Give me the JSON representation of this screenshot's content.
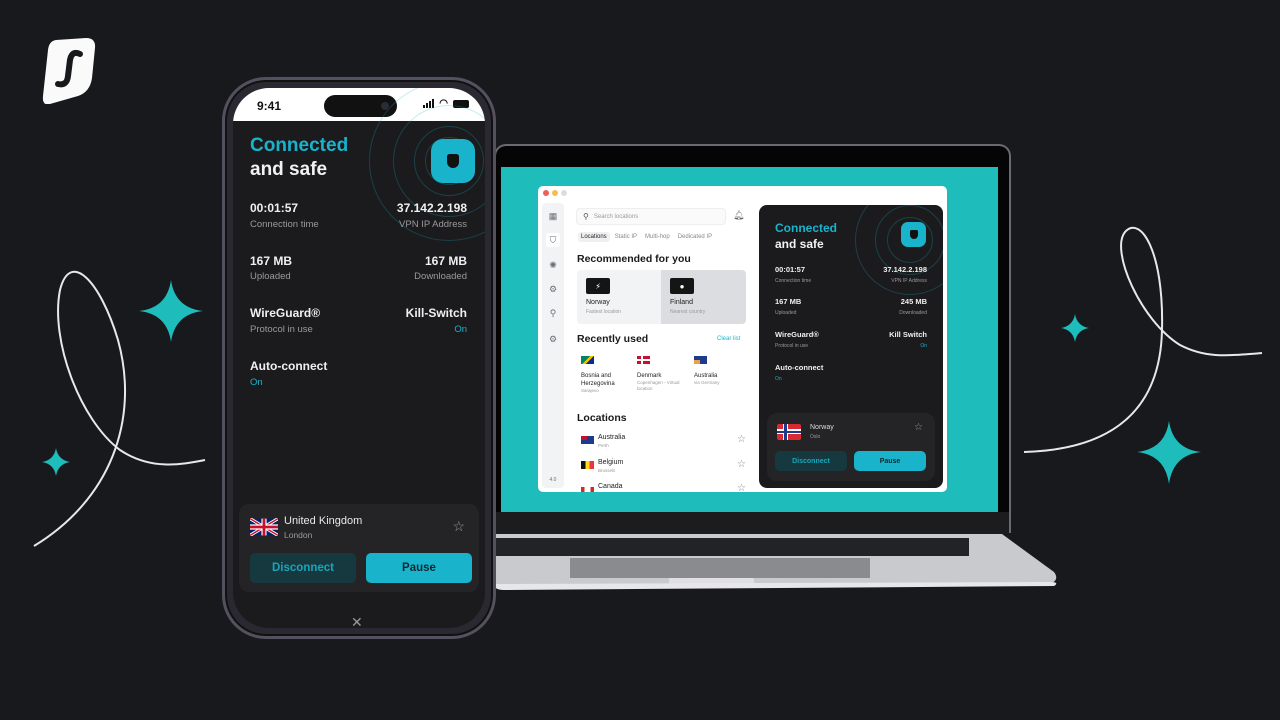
{
  "brand": {
    "logo": "surfshark-logo",
    "accent": "#19b3cc",
    "background": "#17191c"
  },
  "phone": {
    "status_bar": {
      "time": "9:41",
      "icons": [
        "signal-icon",
        "wifi-icon",
        "battery-icon"
      ]
    },
    "status": {
      "line1": "Connected",
      "line2": "and safe",
      "shield_icon": "shield-icon"
    },
    "stats": [
      {
        "value": "00:01:57",
        "label": "Connection time"
      },
      {
        "value": "37.142.2.198",
        "label": "VPN IP Address"
      },
      {
        "value": "167 MB",
        "label": "Uploaded"
      },
      {
        "value": "167 MB",
        "label": "Downloaded"
      },
      {
        "value": "WireGuard®",
        "label": "Protocol in use"
      },
      {
        "value": "Kill-Switch",
        "label": "On"
      },
      {
        "value": "Auto-connect",
        "label": "On"
      }
    ],
    "location": {
      "country": "United Kingdom",
      "city": "London",
      "flag": "uk-flag"
    },
    "disconnect_label": "Disconnect",
    "pause_label": "Pause",
    "close_glyph": "✕"
  },
  "laptop": {
    "app": {
      "search_placeholder": "Search locations",
      "tabs": [
        "Locations",
        "Static IP",
        "Multi-hop",
        "Dedicated IP"
      ],
      "active_tab": "Locations",
      "recommended": {
        "title": "Recommended for you",
        "items": [
          {
            "name": "Norway",
            "sub": "Fastest location",
            "icon": "bolt-icon"
          },
          {
            "name": "Finland",
            "sub": "Nearest country",
            "icon": "pin-icon"
          }
        ]
      },
      "recently_used": {
        "title": "Recently used",
        "clear_label": "Clear list",
        "items": [
          {
            "name": "Bosnia and Herzegovina",
            "sub": "Sarajevo",
            "flag": "ba-flag"
          },
          {
            "name": "Denmark",
            "sub": "Copenhagen - Virtual location",
            "flag": "dk-flag"
          },
          {
            "name": "Australia",
            "sub": "via Germany",
            "flag": "au-flag"
          }
        ]
      },
      "locations": {
        "title": "Locations",
        "items": [
          {
            "name": "Australia",
            "sub": "Perth",
            "flag": "au-flag"
          },
          {
            "name": "Belgium",
            "sub": "Brussels",
            "flag": "be-flag"
          },
          {
            "name": "Canada",
            "sub": "",
            "flag": "ca-flag"
          }
        ]
      },
      "version": "4.0",
      "sidebar_icons": [
        "grid-icon",
        "shield-icon",
        "bug-icon",
        "virus-icon",
        "search-alert-icon",
        "gear-icon"
      ]
    },
    "panel": {
      "status": {
        "line1": "Connected",
        "line2": "and safe"
      },
      "stats": [
        {
          "value": "00:01:57",
          "label": "Connection time"
        },
        {
          "value": "37.142.2.198",
          "label": "VPN IP Address"
        },
        {
          "value": "167 MB",
          "label": "Uploaded"
        },
        {
          "value": "245 MB",
          "label": "Downloaded"
        },
        {
          "value": "WireGuard®",
          "label": "Protocol in use"
        },
        {
          "value": "Kill Switch",
          "label": "On"
        },
        {
          "value": "Auto-connect",
          "label": "On"
        }
      ],
      "location": {
        "country": "Norway",
        "city": "Oslo",
        "flag": "no-flag"
      },
      "disconnect_label": "Disconnect",
      "pause_label": "Pause"
    }
  }
}
